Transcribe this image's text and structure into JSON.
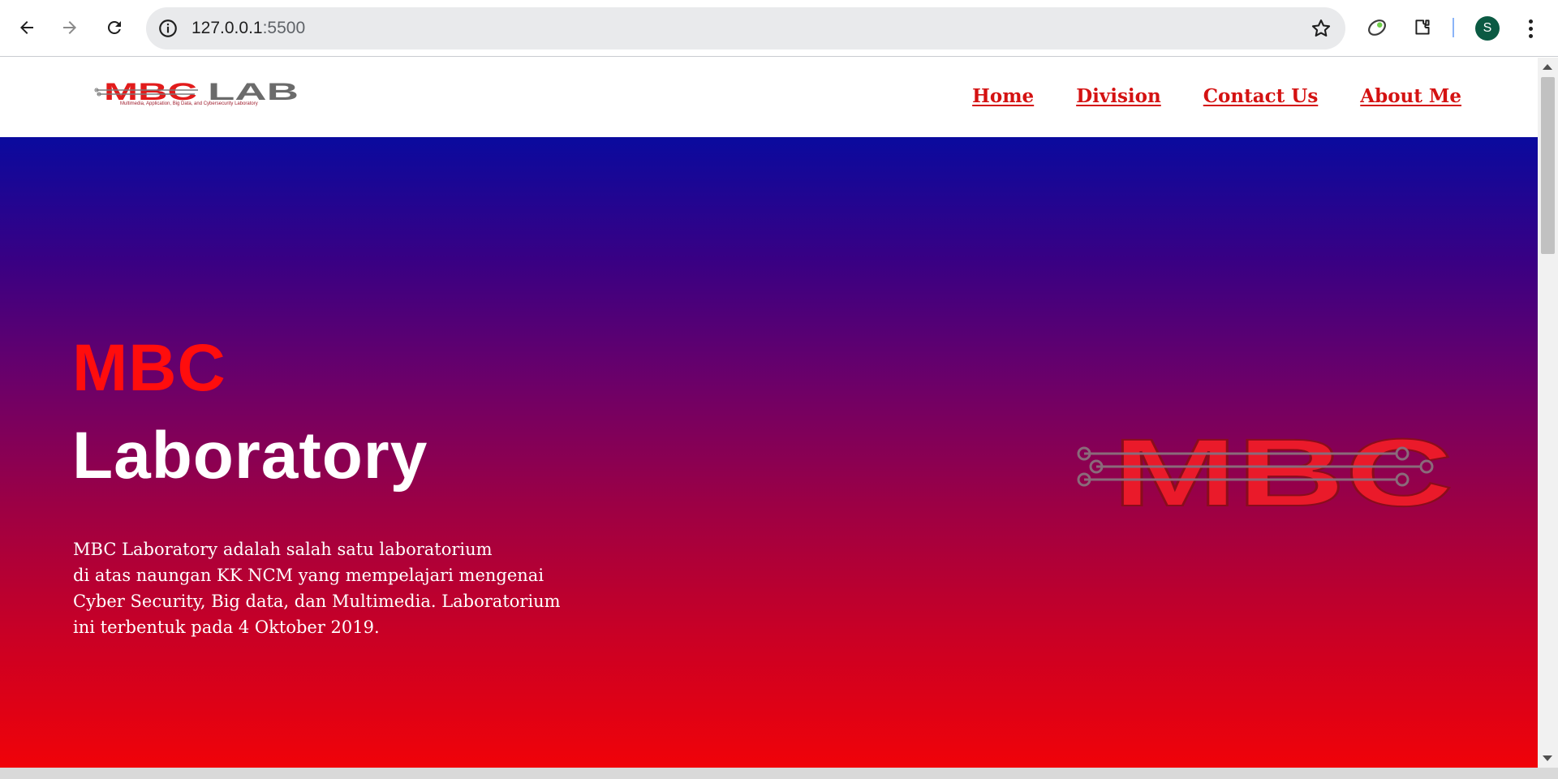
{
  "browser": {
    "url_host": "127.0.0.1",
    "url_port": ":5500",
    "profile_initial": "S",
    "icons": [
      "back-arrow-icon",
      "forward-arrow-icon",
      "reload-icon",
      "site-info-icon",
      "bookmark-star-icon",
      "google-lens-extension-icon",
      "extensions-puzzle-icon",
      "more-menu-icon"
    ]
  },
  "site": {
    "logo": {
      "brand": "MBC",
      "suffix": "LAB",
      "tagline": "Multimedia, Application, Big Data, and Cybersecurity Laboratory"
    },
    "nav": [
      {
        "label": "Home"
      },
      {
        "label": "Division"
      },
      {
        "label": "Contact Us"
      },
      {
        "label": "About Me"
      }
    ],
    "colors": {
      "accent_red": "#ff0d0d",
      "nav_red": "#d41212",
      "gradient_top": "#0a0a9e",
      "gradient_bottom": "#f10208"
    }
  },
  "hero": {
    "title": "MBC",
    "subtitle": "Laboratory",
    "description_lines": [
      "MBC Laboratory adalah salah satu laboratorium",
      "di atas naungan KK NCM yang mempelajari mengenai",
      "Cyber Security, Big data, dan Multimedia. Laboratorium",
      "ini terbentuk pada 4 Oktober 2019."
    ],
    "logo_text": "MBC"
  }
}
